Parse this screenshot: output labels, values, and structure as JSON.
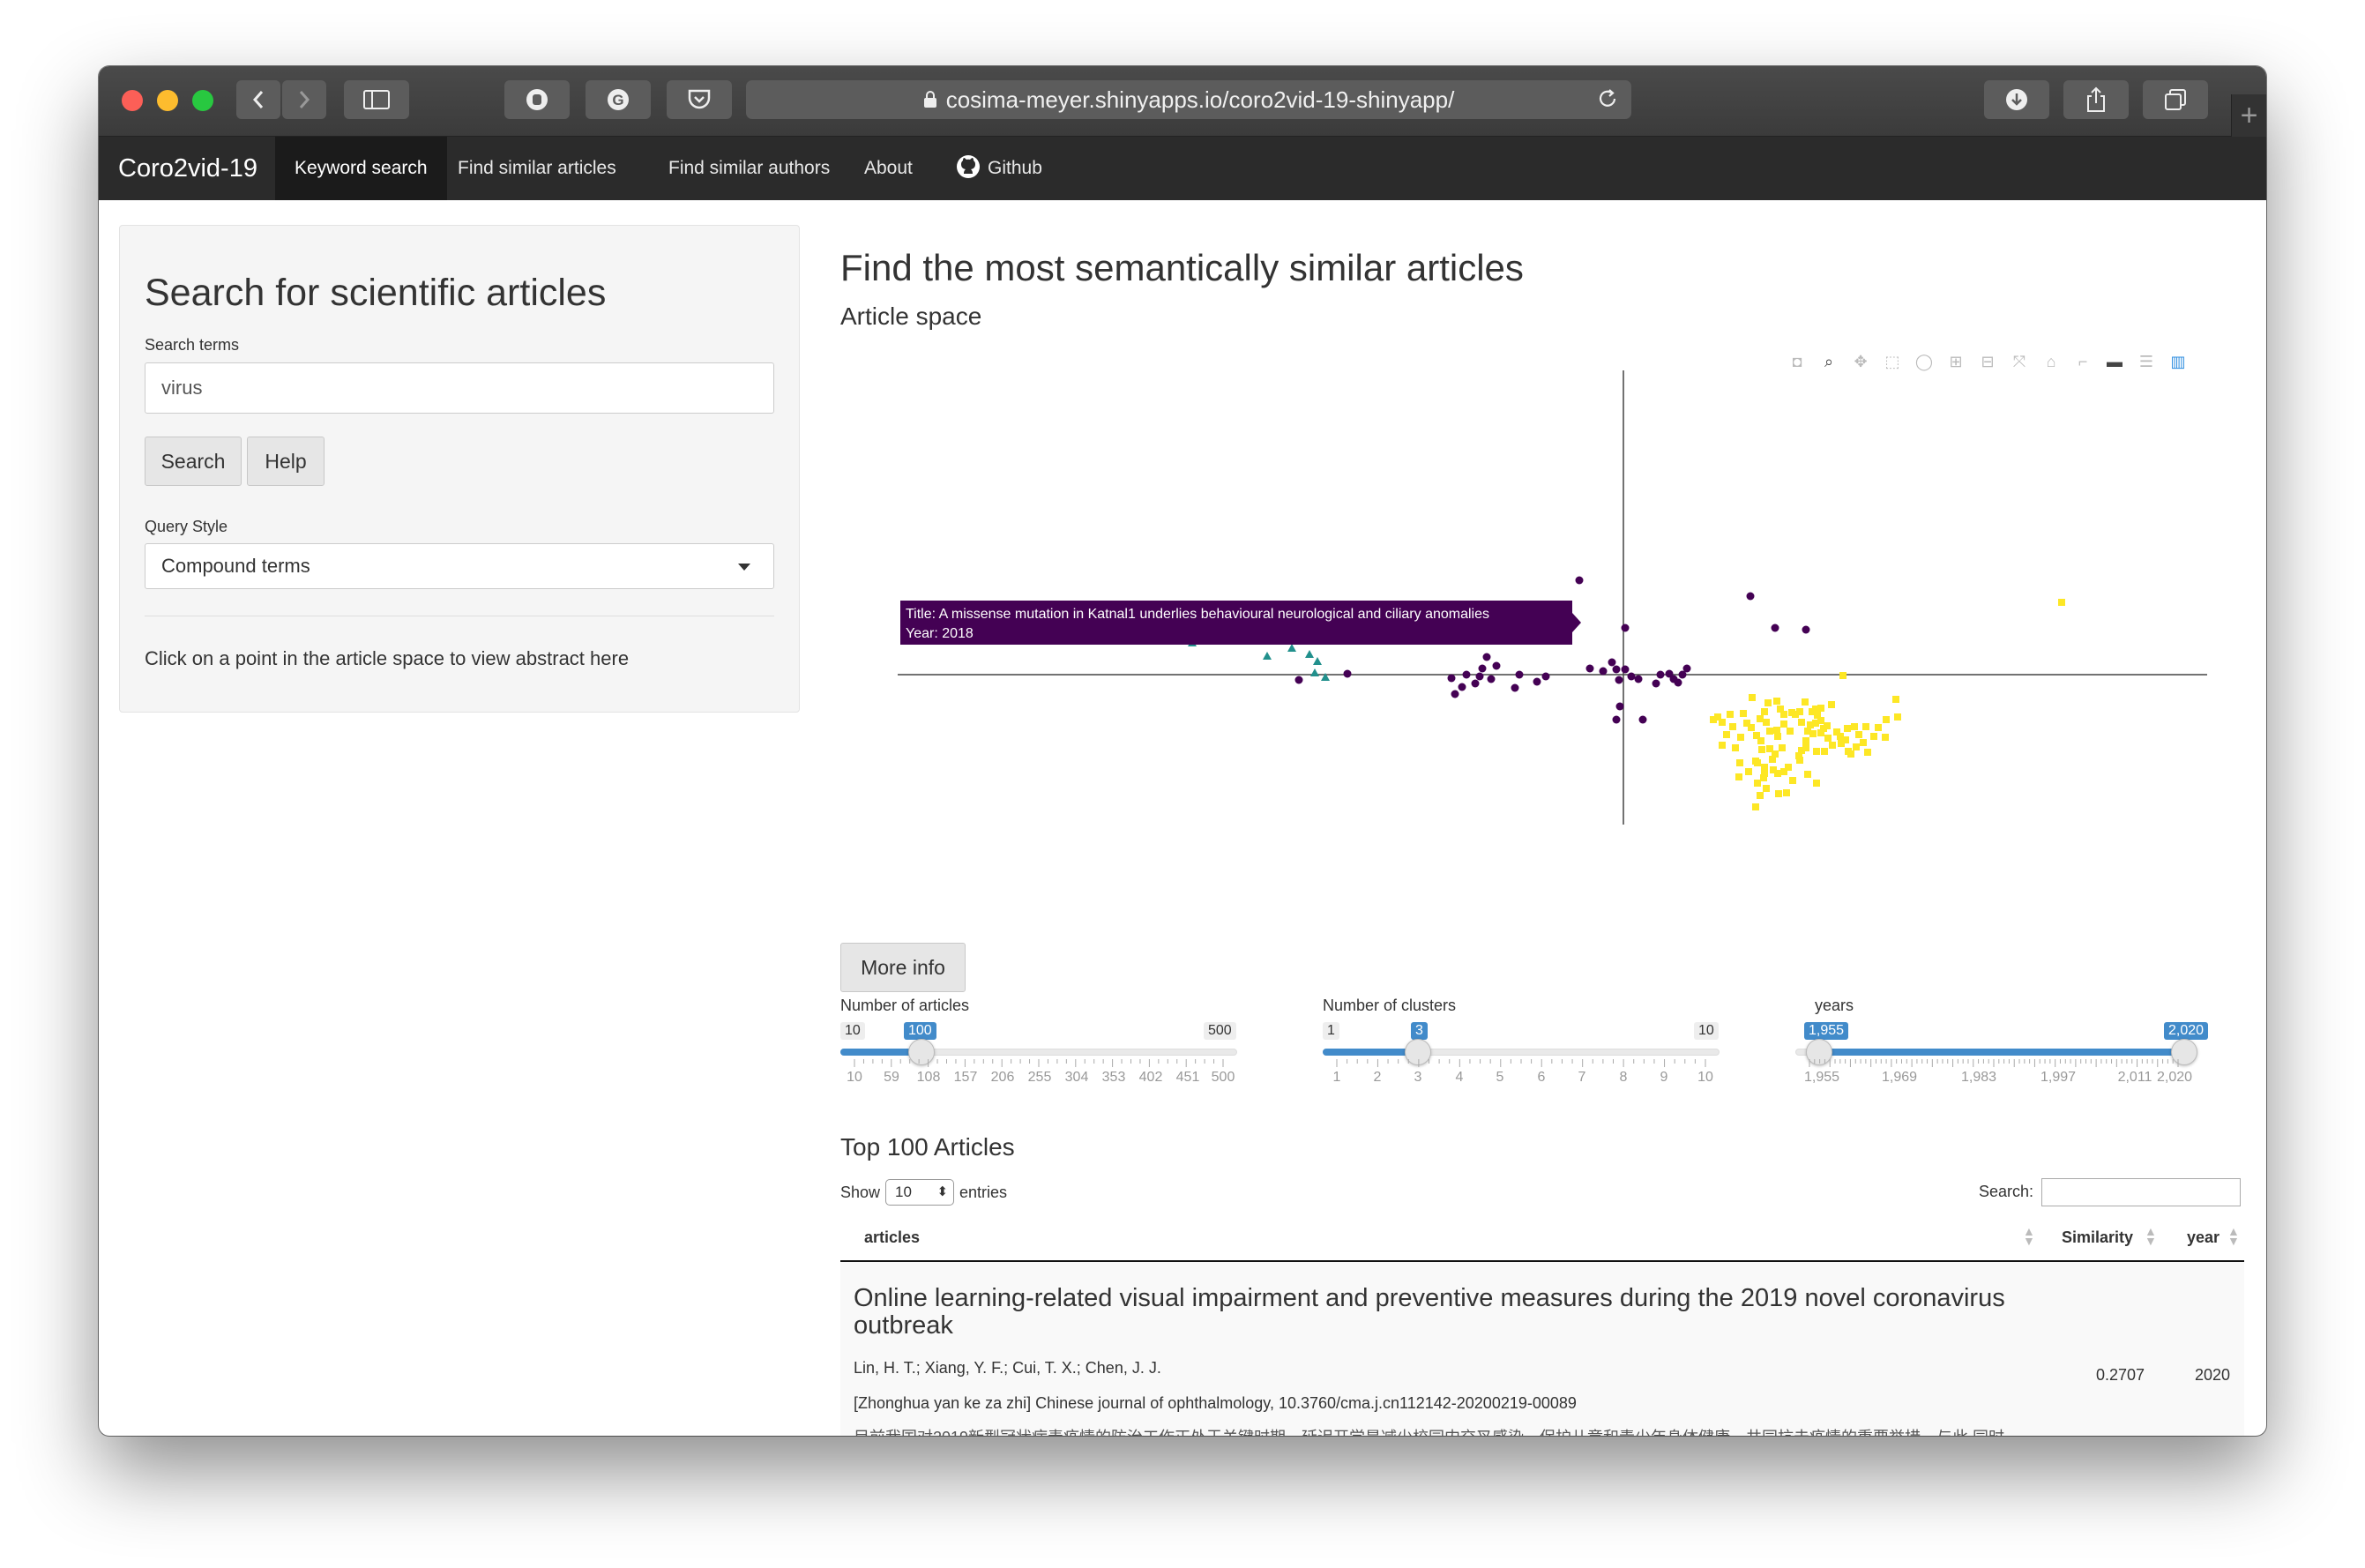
{
  "browser": {
    "url": "cosima-meyer.shinyapps.io/coro2vid-19-shinyapp/"
  },
  "navbar": {
    "brand": "Coro2vid-19",
    "items": [
      {
        "label": "Keyword search",
        "active": true
      },
      {
        "label": "Find similar articles",
        "active": false
      },
      {
        "label": "Find similar authors",
        "active": false
      },
      {
        "label": "About",
        "active": false
      },
      {
        "label": "Github",
        "active": false,
        "icon": "github-icon"
      }
    ]
  },
  "sidebar": {
    "title": "Search for scientific articles",
    "search_label": "Search terms",
    "search_value": "virus",
    "search_button": "Search",
    "help_button": "Help",
    "query_style_label": "Query Style",
    "query_style_value": "Compound terms",
    "hint": "Click on a point in the article space to view abstract here"
  },
  "main": {
    "title": "Find the most semantically similar articles",
    "subtitle": "Article space",
    "more_info_button": "More info"
  },
  "plot": {
    "tooltip_title": "Title: A missense mutation in Katnal1 underlies behavioural neurological and ciliary anomalies",
    "tooltip_year": "Year: 2018",
    "cluster_colors": {
      "purple": "#440154",
      "teal": "#21908c",
      "yellow": "#fde725"
    },
    "toolbar_icons": [
      "camera-icon",
      "zoom-icon",
      "pan-icon",
      "box-select-icon",
      "lasso-icon",
      "zoom-in-icon",
      "zoom-out-icon",
      "autoscale-icon",
      "reset-axes-icon",
      "spike-lines-icon",
      "hover-closest-icon",
      "hover-compare-icon",
      "plotly-logo-icon"
    ]
  },
  "sliders": [
    {
      "label": "Number of articles",
      "min": "10",
      "max": "500",
      "value": "100",
      "fraction": 0.18,
      "ticks": [
        "10",
        "59",
        "108",
        "157",
        "206",
        "255",
        "304",
        "353",
        "402",
        "451",
        "500"
      ]
    },
    {
      "label": "Number of clusters",
      "min": "1",
      "max": "10",
      "value": "3",
      "fraction": 0.222,
      "ticks": [
        "1",
        "2",
        "3",
        "4",
        "5",
        "6",
        "7",
        "8",
        "9",
        "10"
      ]
    },
    {
      "label": "years",
      "min": "",
      "max": "",
      "range_low": "1,955",
      "range_high": "2,020",
      "ticks": [
        "1,955",
        "1,969",
        "1,983",
        "1,997",
        "2,011",
        "2,020"
      ]
    }
  ],
  "table": {
    "title": "Top 100 Articles",
    "show_label": "Show",
    "entries_value": "10",
    "entries_label": "entries",
    "search_label": "Search:",
    "columns": [
      "articles",
      "Similarity",
      "year"
    ],
    "rows": [
      {
        "title": "Online learning-related visual impairment and preventive measures during the 2019 novel coronavirus outbreak",
        "authors": "Lin, H. T.; Xiang, Y. F.; Cui, T. X.; Chen, J. J.",
        "journal": "[Zhonghua yan ke za zhi] Chinese journal of ophthalmology, 10.3760/cma.j.cn112142-20200219-00089",
        "abstract": "目前我国对2019新型冠状病毒疫情的防治工作正处于关键时期，延迟开学是减少校园内交叉感染，保护儿童和青少年身体健康，共同抗击疫情的重要举措。与此 同时",
        "similarity": "0.2707",
        "year": "2020"
      }
    ]
  }
}
